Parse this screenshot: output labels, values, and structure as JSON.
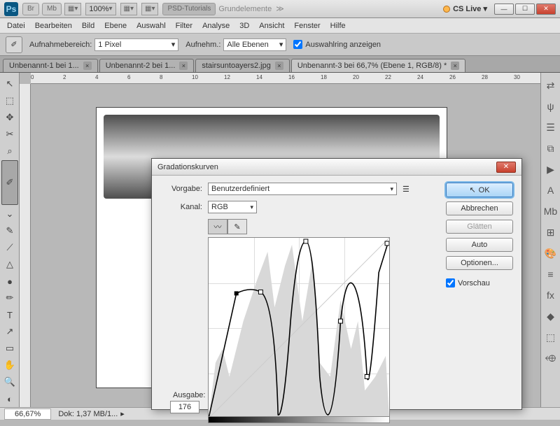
{
  "topbar": {
    "br": "Br",
    "mb": "Mb",
    "zoom": "100%",
    "psd": "PSD-Tutorials",
    "grund": "Grundelemente",
    "more": "≫",
    "cs": "CS Live ▾"
  },
  "menu": [
    "Datei",
    "Bearbeiten",
    "Bild",
    "Ebene",
    "Auswahl",
    "Filter",
    "Analyse",
    "3D",
    "Ansicht",
    "Fenster",
    "Hilfe"
  ],
  "options": {
    "sample_lbl": "Aufnahmebereich:",
    "sample_val": "1 Pixel",
    "sample2_lbl": "Aufnehm.:",
    "sample2_val": "Alle Ebenen",
    "ring": "Auswahlring anzeigen"
  },
  "tabs": [
    {
      "label": "Unbenannt-1 bei 1..."
    },
    {
      "label": "Unbenannt-2 bei 1..."
    },
    {
      "label": "stairsuntoayers2.jpg"
    },
    {
      "label": "Unbenannt-3 bei 66,7% (Ebene 1, RGB/8) *",
      "active": true
    }
  ],
  "ruler_ticks": [
    "0",
    "2",
    "4",
    "6",
    "8",
    "10",
    "12",
    "14",
    "16",
    "18",
    "20",
    "22",
    "24",
    "26",
    "28",
    "30"
  ],
  "statusbar": {
    "zoom": "66,67%",
    "doc": "Dok: 1,37 MB/1..."
  },
  "dialog": {
    "title": "Gradationskurven",
    "preset_lbl": "Vorgabe:",
    "preset_val": "Benutzerdefiniert",
    "channel_lbl": "Kanal:",
    "channel_val": "RGB",
    "output_lbl": "Ausgabe:",
    "output_val": "176",
    "ok": "OK",
    "cancel": "Abbrechen",
    "smooth": "Glätten",
    "auto": "Auto",
    "opts": "Optionen...",
    "preview": "Vorschau"
  },
  "tools": [
    "↖",
    "⬚",
    "✥",
    "✂",
    "⌕",
    "✐",
    "⌄",
    "✎",
    "⟋",
    "△",
    "●",
    "✏",
    "T",
    "↗",
    "▭",
    "✋",
    "🔍",
    "◐"
  ],
  "right_icons": [
    "⇄",
    "ψ",
    "☰",
    "⧉",
    "▶",
    "A",
    "Mb",
    "⊞",
    "🎨",
    "≡",
    "fx",
    "◆",
    "⬚",
    "⬲"
  ]
}
